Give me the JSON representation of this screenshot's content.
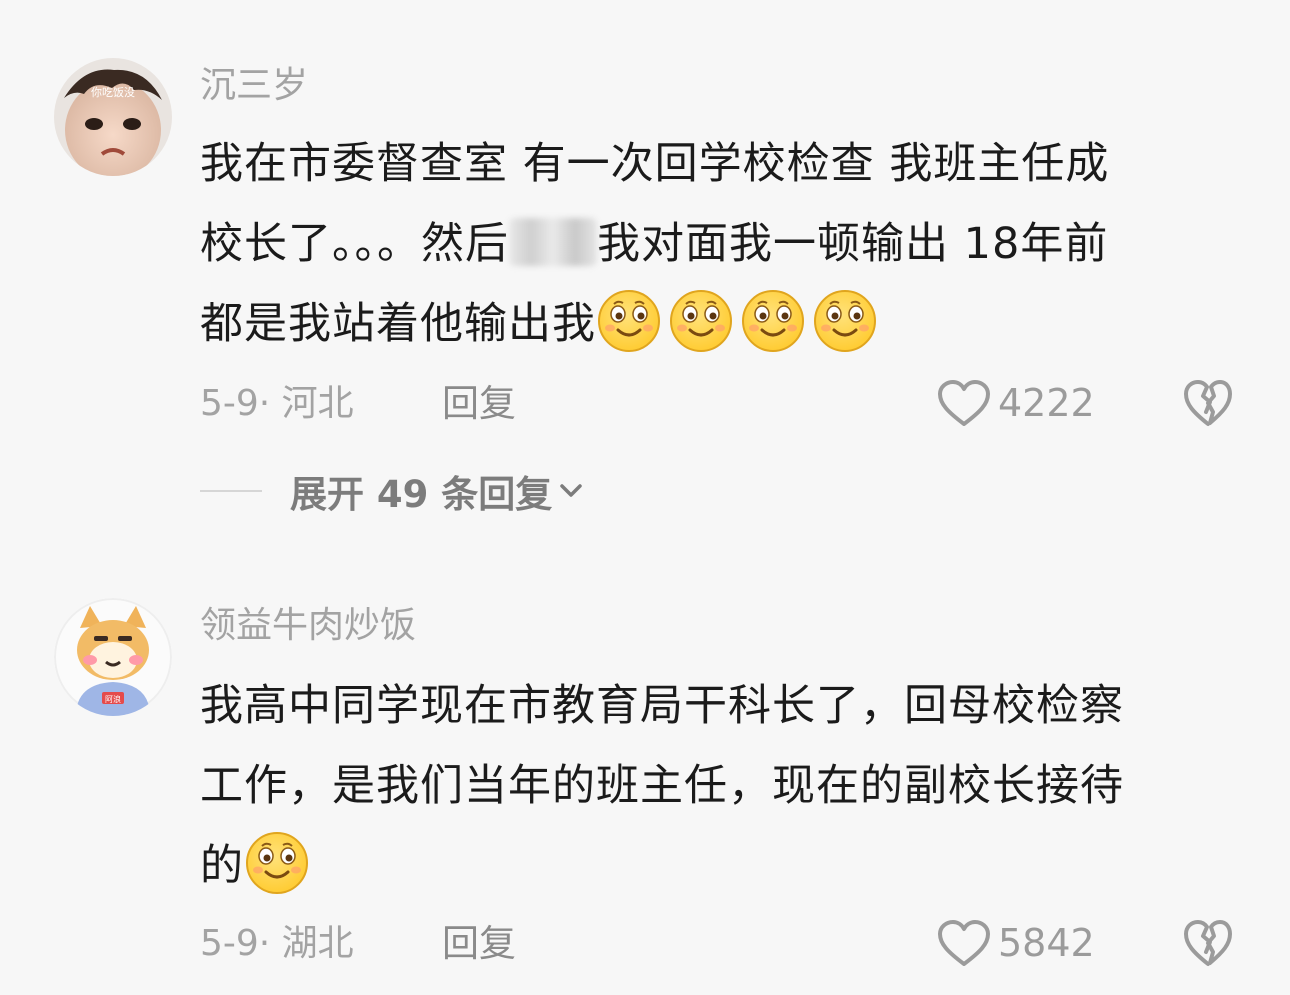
{
  "comments": [
    {
      "username": "沉三岁",
      "avatar_label": "你吃饭没",
      "text_lines": [
        "我在市委督查室 有一次回学校检查 我班主任成",
        "校长了。。。然后",
        "我对面我一顿输出 18年前",
        "都是我站着他输出我"
      ],
      "emoji_count": 4,
      "date_location": "5-9· 河北",
      "reply_label": "回复",
      "like_count": "4222",
      "expand_label": "展开 49 条回复"
    },
    {
      "username": "领益牛肉炒饭",
      "avatar_label": "阿浪",
      "text_lines": [
        "我高中同学现在市教育局干科长了，回母校检察",
        "工作，是我们当年的班主任，现在的副校长接待",
        "的"
      ],
      "emoji_count": 1,
      "date_location": "5-9· 湖北",
      "reply_label": "回复",
      "like_count": "5842"
    }
  ],
  "icons": {
    "like": "heart-outline-icon",
    "dislike": "broken-heart-icon",
    "expand": "chevron-down-icon",
    "emoji": "smile-emoji-icon"
  },
  "colors": {
    "background": "#f7f7f7",
    "text": "#1b1b1b",
    "meta": "#a3a3a3",
    "emoji_face": "#ffcc33"
  }
}
